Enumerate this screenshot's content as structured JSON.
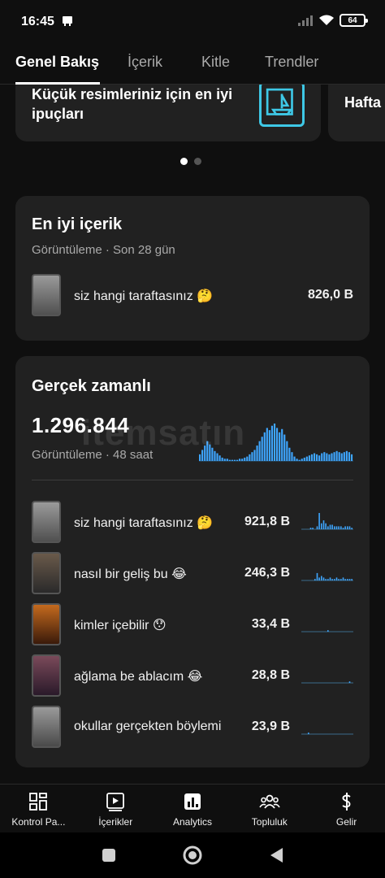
{
  "status": {
    "time": "16:45",
    "battery": "64"
  },
  "tabs": [
    {
      "label": "Genel Bakış"
    },
    {
      "label": "İçerik"
    },
    {
      "label": "Kitle"
    },
    {
      "label": "Trendler"
    }
  ],
  "carousel": {
    "card1_text": "Küçük resimleriniz için en iyi ipuçları",
    "card2_text": "Hafta"
  },
  "top_content": {
    "title": "En iyi içerik",
    "subtitle": "Görüntüleme · Son 28 gün",
    "video": {
      "title": "siz hangi taraftasınız 🤔",
      "value": "826,0 B"
    }
  },
  "realtime": {
    "title": "Gerçek zamanlı",
    "total": "1.296.844",
    "subtitle": "Görüntüleme · 48 saat",
    "videos": [
      {
        "title": "siz hangi taraftasınız 🤔",
        "value": "921,8 B"
      },
      {
        "title": "nasıl bir geliş bu 😂",
        "value": "246,3 B"
      },
      {
        "title": "kimler içebilir 😯",
        "value": "33,4 B"
      },
      {
        "title": "ağlama be ablacım 😂",
        "value": "28,8 B"
      },
      {
        "title": "okullar gerçekten böylemi",
        "value": "23,9 B"
      }
    ],
    "accent_color": "#3ea6ff"
  },
  "watermark": "itemsatın",
  "bottom_nav": [
    {
      "label": "Kontrol Pa...",
      "icon": "dashboard-icon"
    },
    {
      "label": "İçerikler",
      "icon": "content-icon"
    },
    {
      "label": "Analytics",
      "icon": "analytics-icon"
    },
    {
      "label": "Topluluk",
      "icon": "community-icon"
    },
    {
      "label": "Gelir",
      "icon": "dollar-icon"
    }
  ]
}
